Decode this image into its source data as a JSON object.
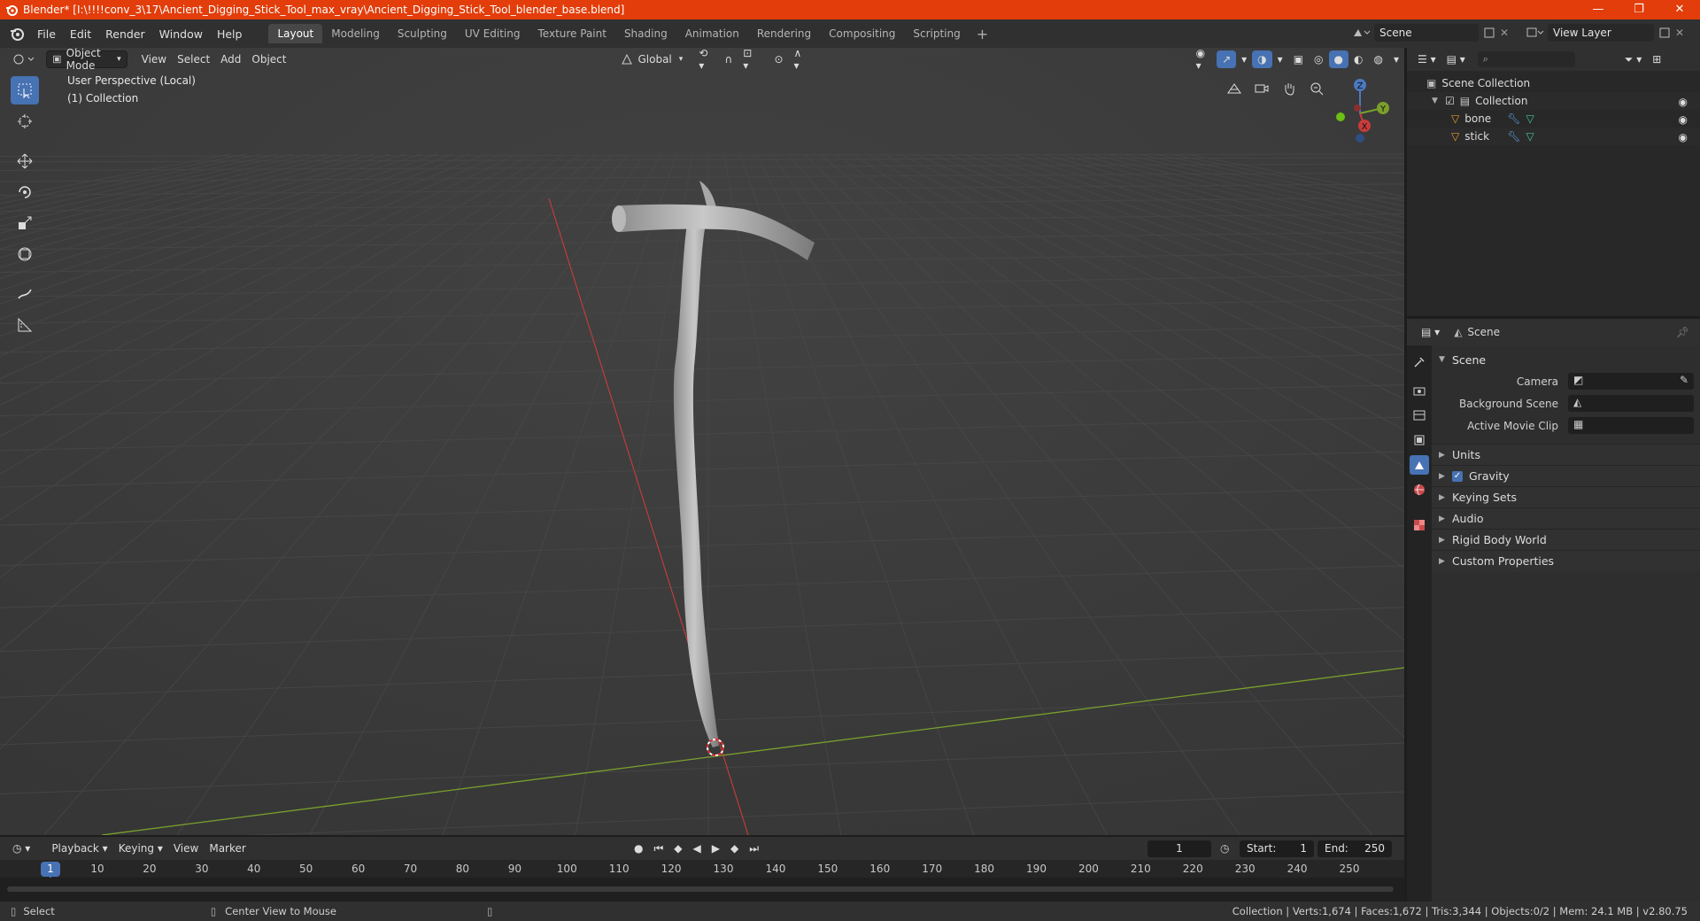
{
  "window": {
    "title": "Blender* [I:\\!!!!conv_3\\17\\Ancient_Digging_Stick_Tool_max_vray\\Ancient_Digging_Stick_Tool_blender_base.blend]",
    "minimize": "—",
    "maximize": "❐",
    "close": "✕"
  },
  "menu": [
    "File",
    "Edit",
    "Render",
    "Window",
    "Help"
  ],
  "workspaces": [
    "Layout",
    "Modeling",
    "Sculpting",
    "UV Editing",
    "Texture Paint",
    "Shading",
    "Animation",
    "Rendering",
    "Compositing",
    "Scripting"
  ],
  "active_workspace": "Layout",
  "scene_name": "Scene",
  "view_layer": "View Layer",
  "viewport": {
    "mode": "Object Mode",
    "menus": [
      "View",
      "Select",
      "Add",
      "Object"
    ],
    "orientation": "Global",
    "overlay_line1": "User Perspective (Local)",
    "overlay_line2": "(1) Collection",
    "gizmo": {
      "z": "Z",
      "y": "Y",
      "x": "X"
    }
  },
  "outliner": {
    "root": "Scene Collection",
    "collection": "Collection",
    "objects": [
      "bone",
      "stick"
    ]
  },
  "properties": {
    "context": "Scene",
    "panel": "Scene",
    "fields": [
      {
        "label": "Camera"
      },
      {
        "label": "Background Scene"
      },
      {
        "label": "Active Movie Clip"
      }
    ],
    "subpanels": [
      "Units",
      "Gravity",
      "Keying Sets",
      "Audio",
      "Rigid Body World",
      "Custom Properties"
    ]
  },
  "timeline": {
    "menus": [
      "Playback",
      "Keying",
      "View",
      "Marker"
    ],
    "current_frame": "1",
    "start_label": "Start:",
    "start": "1",
    "end_label": "End:",
    "end": "250",
    "ticks": [
      "1",
      "10",
      "20",
      "30",
      "40",
      "50",
      "60",
      "70",
      "80",
      "90",
      "100",
      "110",
      "120",
      "130",
      "140",
      "150",
      "160",
      "170",
      "180",
      "190",
      "200",
      "210",
      "220",
      "230",
      "240",
      "250"
    ]
  },
  "status": {
    "left": "Select",
    "middle": "Center View to Mouse",
    "right": "Collection | Verts:1,674 | Faces:1,672 | Tris:3,344 | Objects:0/2 | Mem: 24.1 MB | v2.80.75"
  },
  "colors": {
    "accent": "#4772b3",
    "titlebar": "#e23d0a",
    "x_axis": "#c93c3c",
    "y_axis": "#7aa02c"
  }
}
